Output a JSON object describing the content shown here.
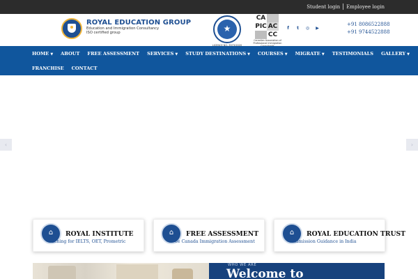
{
  "topbar": {
    "student_login": "Student login",
    "employee_login": "Employee login"
  },
  "header": {
    "logo_title": "ROYAL EDUCATION GROUP",
    "logo_line1": "Education and Immigration Consultancy",
    "logo_line2": "ISO certified group",
    "iso_caption": "LICENCE NO. 3573/2020",
    "capic_letters": [
      "CA",
      "",
      "PIC",
      "AC",
      "",
      "CC"
    ],
    "capic_caption_1": "Canadian Association of",
    "capic_caption_2": "Professional Immigration Consultants",
    "social_icons": [
      "facebook-icon",
      "twitter-icon",
      "instagram-icon",
      "youtube-icon"
    ],
    "phone_1": "+91 8086522888",
    "phone_2": "+91 9744522888"
  },
  "nav": {
    "row1": [
      {
        "label": "HOME",
        "dropdown": true
      },
      {
        "label": "ABOUT",
        "dropdown": false
      },
      {
        "label": "FREE ASSESSMENT",
        "dropdown": false
      },
      {
        "label": "SERVICES",
        "dropdown": true
      },
      {
        "label": "STUDY DESTINATIONS",
        "dropdown": true
      },
      {
        "label": "COURSES",
        "dropdown": true
      },
      {
        "label": "MIGRATE",
        "dropdown": true
      },
      {
        "label": "TESTIMONIALS",
        "dropdown": false
      },
      {
        "label": "GALLERY",
        "dropdown": true
      }
    ],
    "row2": [
      {
        "label": "FRANCHISE",
        "dropdown": false
      },
      {
        "label": "CONTACT",
        "dropdown": false
      }
    ]
  },
  "slider": {
    "prev_glyph": "‹",
    "next_glyph": "›"
  },
  "cards": [
    {
      "title": "ROYAL INSTITUTE",
      "subtitle": "aching for IELTS, OET, Prometric",
      "icon": "institute-building-icon"
    },
    {
      "title": "FREE ASSESSMENT",
      "subtitle": "ee Canada Immigration Assessment",
      "icon": "assessment-building-icon"
    },
    {
      "title": "ROYAL EDUCATION TRUST",
      "subtitle": "Admission Guidance in India",
      "icon": "trust-building-icon"
    }
  ],
  "welcome": {
    "label": "WHO WE ARE",
    "title": "Welcome to"
  },
  "colors": {
    "brand_blue": "#10569d",
    "dark_blue": "#17427d",
    "accent_gold": "#f0b53a",
    "topbar": "#2c2c2c"
  }
}
